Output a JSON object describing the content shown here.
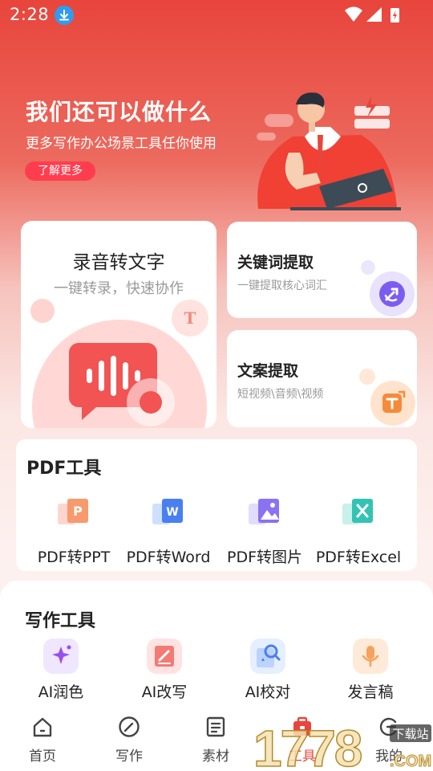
{
  "status_bar": {
    "time": "2:28",
    "icons": [
      "download-badge-icon",
      "wifi-icon",
      "signal-icon",
      "battery-charging-icon"
    ]
  },
  "banner": {
    "title": "我们还可以做什么",
    "subtitle": "更多写作办公场景工具任你使用",
    "button": "了解更多"
  },
  "feature_cards": {
    "audio": {
      "title": "录音转文字",
      "subtitle": "一键转录，快速协作",
      "deco_letter": "T",
      "icon": "audio-waveform-icon"
    },
    "keyword": {
      "title": "关键词提取",
      "subtitle": "一键提取核心词汇",
      "icon": "keyword-extract-icon"
    },
    "copy": {
      "title": "文案提取",
      "subtitle": "短视频\\音频\\视频",
      "icon": "text-extract-icon"
    }
  },
  "pdf_tools": {
    "title": "PDF工具",
    "items": [
      {
        "label": "PDF转PPT",
        "icon": "pdf-to-ppt-icon"
      },
      {
        "label": "PDF转Word",
        "icon": "pdf-to-word-icon"
      },
      {
        "label": "PDF转图片",
        "icon": "pdf-to-image-icon"
      },
      {
        "label": "PDF转Excel",
        "icon": "pdf-to-excel-icon"
      }
    ]
  },
  "writing_tools": {
    "title": "写作工具",
    "items": [
      {
        "label": "AI润色",
        "icon": "ai-polish-icon"
      },
      {
        "label": "AI改写",
        "icon": "ai-rewrite-icon"
      },
      {
        "label": "AI校对",
        "icon": "ai-proofread-icon"
      },
      {
        "label": "发言稿",
        "icon": "speech-draft-icon"
      }
    ]
  },
  "bottom_nav": {
    "items": [
      {
        "label": "首页",
        "icon": "home-icon"
      },
      {
        "label": "写作",
        "icon": "pen-circle-icon"
      },
      {
        "label": "素材",
        "icon": "document-icon"
      },
      {
        "label": "工具",
        "icon": "toolbox-icon"
      },
      {
        "label": "我的",
        "icon": "profile-icon"
      }
    ],
    "active": "工具"
  },
  "watermark": {
    "brand": "1778",
    "suffix": ".COM",
    "tag": "下载站"
  },
  "colors": {
    "brand_red": "#e8453c",
    "button_red": "#ff3d4f",
    "purple": "#7b5cf0",
    "orange": "#f5a25d",
    "text_dark": "#222222",
    "text_gray": "#9a9a9a"
  }
}
